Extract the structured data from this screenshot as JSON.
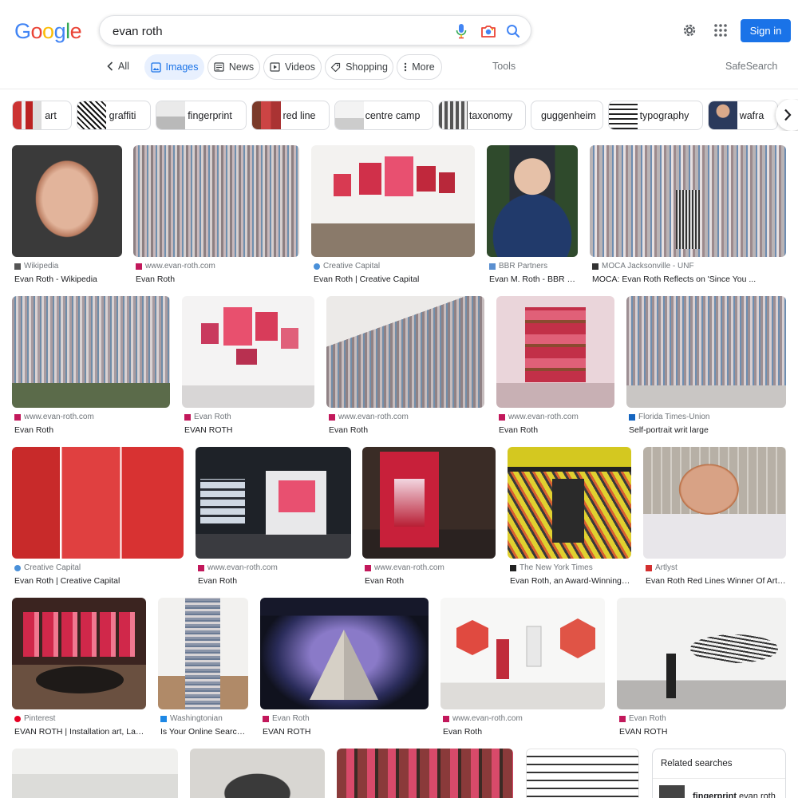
{
  "logo": {
    "text": "Google",
    "letters": [
      "G",
      "o",
      "o",
      "g",
      "l",
      "e"
    ],
    "colors": [
      "#4285f4",
      "#ea4335",
      "#fbbc05",
      "#4285f4",
      "#34a853",
      "#ea4335"
    ]
  },
  "search": {
    "query": "evan roth"
  },
  "header": {
    "sign_in": "Sign in"
  },
  "tabs": {
    "all": "All",
    "images": "Images",
    "news": "News",
    "videos": "Videos",
    "shopping": "Shopping",
    "more": "More",
    "tools": "Tools",
    "safesearch": "SafeSearch"
  },
  "chips": [
    "art",
    "graffiti",
    "fingerprint",
    "red line",
    "centre camp",
    "taxonomy",
    "guggenheim",
    "typography",
    "wafra"
  ],
  "results": [
    {
      "source": "Wikipedia",
      "title": "Evan Roth - Wikipedia",
      "fav": "#555555"
    },
    {
      "source": "www.evan-roth.com",
      "title": "Evan Roth",
      "fav": "#c2185b"
    },
    {
      "source": "Creative Capital",
      "title": "Evan Roth | Creative Capital",
      "fav": "#4a90d9"
    },
    {
      "source": "BBR Partners",
      "title": "Evan M. Roth - BBR Par...",
      "fav": "#5a8fd0"
    },
    {
      "source": "MOCA Jacksonville - UNF",
      "title": "MOCA: Evan Roth Reflects on 'Since You ...",
      "fav": "#333333"
    },
    {
      "source": "www.evan-roth.com",
      "title": "Evan Roth",
      "fav": "#c2185b"
    },
    {
      "source": "Evan Roth",
      "title": "EVAN ROTH",
      "fav": "#c2185b"
    },
    {
      "source": "www.evan-roth.com",
      "title": "Evan Roth",
      "fav": "#c2185b"
    },
    {
      "source": "www.evan-roth.com",
      "title": "Evan Roth",
      "fav": "#c2185b"
    },
    {
      "source": "Florida Times-Union",
      "title": "Self-portrait writ large",
      "fav": "#1565c0"
    },
    {
      "source": "Creative Capital",
      "title": "Evan Roth | Creative Capital",
      "fav": "#4a90d9"
    },
    {
      "source": "www.evan-roth.com",
      "title": "Evan Roth",
      "fav": "#c2185b"
    },
    {
      "source": "www.evan-roth.com",
      "title": "Evan Roth",
      "fav": "#c2185b"
    },
    {
      "source": "The New York Times",
      "title": "Evan Roth, an Award-Winning De...",
      "fav": "#222222"
    },
    {
      "source": "Artlyst",
      "title": "Evan Roth Red Lines Winner Of Artang...",
      "fav": "#d32f2f"
    },
    {
      "source": "Pinterest",
      "title": "EVAN ROTH | Installation art, Lands...",
      "fav": "#e60023"
    },
    {
      "source": "Washingtonian",
      "title": "Is Your Online Search ...",
      "fav": "#1e88e5"
    },
    {
      "source": "Evan Roth",
      "title": "EVAN ROTH",
      "fav": "#c2185b"
    },
    {
      "source": "www.evan-roth.com",
      "title": "Evan Roth",
      "fav": "#c2185b"
    },
    {
      "source": "Evan Roth",
      "title": "EVAN ROTH",
      "fav": "#c2185b"
    }
  ],
  "related": {
    "title": "Related searches",
    "item_bold": "fingerprint",
    "item_rest": " evan roth"
  }
}
